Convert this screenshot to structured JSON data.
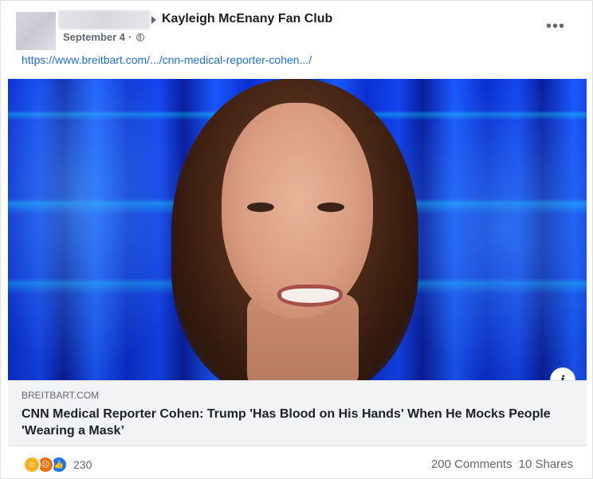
{
  "header": {
    "group_name": "Kayleigh McEnany Fan Club",
    "date": "September 4",
    "separator": "·",
    "privacy_icon": "globe-icon",
    "more_icon": "more-options-icon"
  },
  "post": {
    "link_text": "https://www.breitbart.com/.../cnn-medical-reporter-cohen.../"
  },
  "link_card": {
    "domain": "BREITBART.COM",
    "title": "CNN Medical Reporter Cohen: Trump 'Has Blood on His Hands' When He Mocks People 'Wearing a Mask’",
    "info_icon": "i"
  },
  "footer": {
    "reactions": [
      "haha",
      "angry",
      "like"
    ],
    "reaction_count": "230",
    "comments": "200 Comments",
    "shares": "10 Shares"
  },
  "colors": {
    "link": "#1a6fd6",
    "haha": "#f7b125",
    "angry": "#e9710f",
    "like": "#1877f2"
  }
}
